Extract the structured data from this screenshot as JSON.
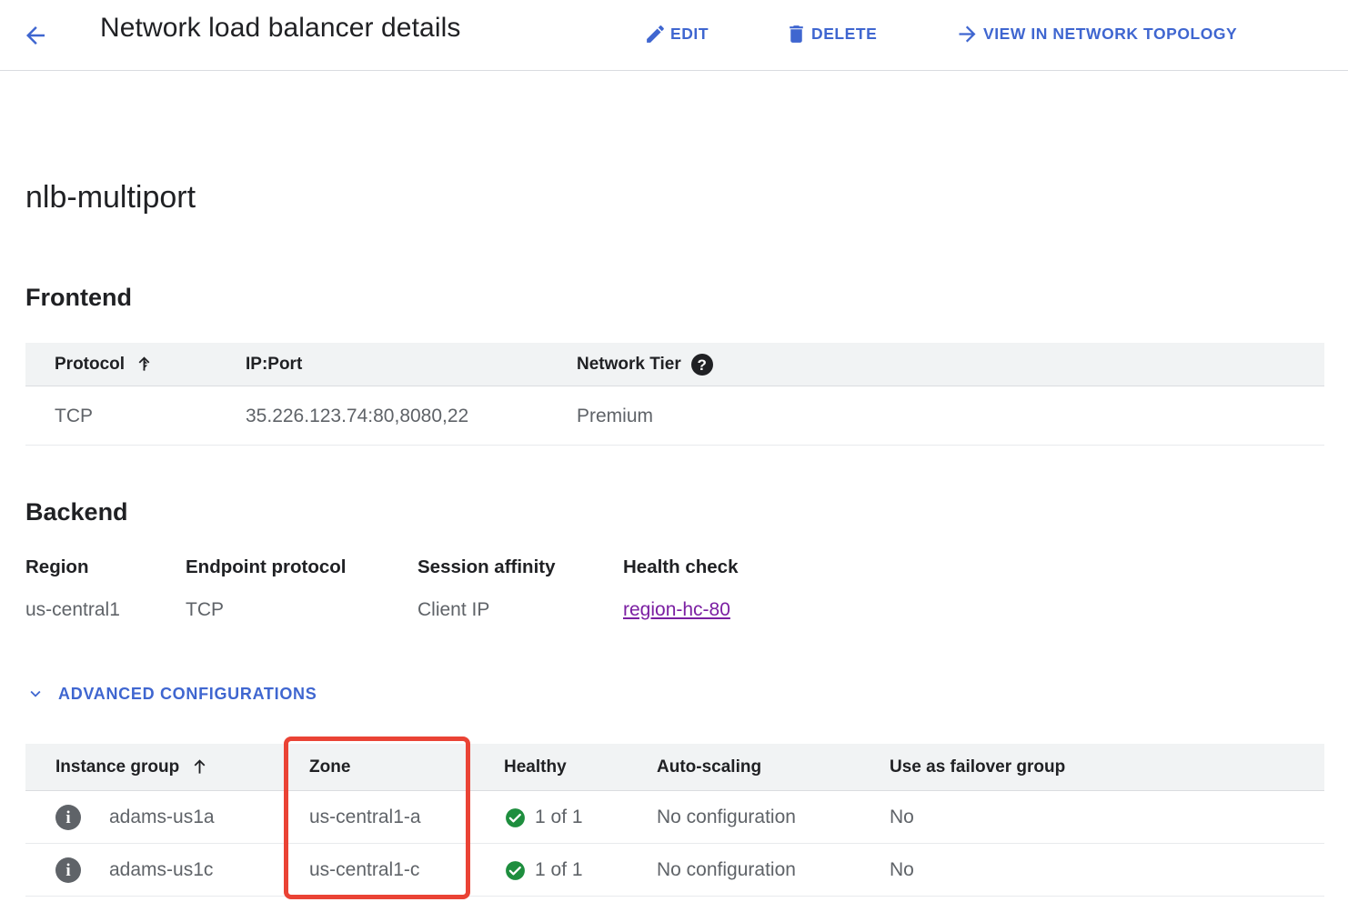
{
  "header": {
    "back_icon": "arrow-left-icon",
    "title": "Network load balancer details",
    "actions": [
      {
        "label": "EDIT",
        "icon": "pencil-icon"
      },
      {
        "label": "DELETE",
        "icon": "trash-icon"
      },
      {
        "label": "VIEW IN NETWORK TOPOLOGY",
        "icon": "arrow-right-icon"
      }
    ]
  },
  "resource": {
    "name": "nlb-multiport"
  },
  "frontend": {
    "heading": "Frontend",
    "columns": [
      {
        "label": "Protocol",
        "sort_icon": "arrow-up-icon"
      },
      {
        "label": "IP:Port"
      },
      {
        "label": "Network Tier",
        "help_icon": "help-circle-icon"
      }
    ],
    "rows": [
      {
        "protocol": "TCP",
        "ip_port": "35.226.123.74:80,8080,22",
        "network_tier": "Premium"
      }
    ]
  },
  "backend": {
    "heading": "Backend",
    "properties": [
      {
        "label": "Region",
        "value": "us-central1"
      },
      {
        "label": "Endpoint protocol",
        "value": "TCP"
      },
      {
        "label": "Session affinity",
        "value": "Client IP"
      },
      {
        "label": "Health check",
        "value": "region-hc-80",
        "is_link": true
      }
    ],
    "advanced_configurations": {
      "label": "ADVANCED CONFIGURATIONS",
      "expand_icon": "chevron-down-icon",
      "expanded": true
    },
    "instance_table": {
      "columns": [
        {
          "label": "Instance group",
          "sort_icon": "arrow-up-icon"
        },
        {
          "label": "Zone"
        },
        {
          "label": "Healthy"
        },
        {
          "label": "Auto-scaling"
        },
        {
          "label": "Use as failover group"
        }
      ],
      "rows": [
        {
          "info_icon": "info-circle-icon",
          "instance_group": "adams-us1a",
          "zone": "us-central1-a",
          "health_icon": "check-circle-icon",
          "healthy": "1 of 1",
          "auto_scaling": "No configuration",
          "failover": "No"
        },
        {
          "info_icon": "info-circle-icon",
          "instance_group": "adams-us1c",
          "zone": "us-central1-c",
          "health_icon": "check-circle-icon",
          "healthy": "1 of 1",
          "auto_scaling": "No configuration",
          "failover": "No"
        }
      ]
    }
  },
  "annotation": {
    "highlight_target": "Zone column",
    "color": "#ea4335"
  },
  "colors": {
    "accent_blue": "#3f66d0",
    "link_purple": "#7b1fa2",
    "health_green": "#1e8e3e",
    "header_row_bg": "#f1f3f4",
    "text_primary": "#202124",
    "text_secondary": "#5f6368",
    "text_muted": "#9aa0a6",
    "divider": "#e8eaed"
  }
}
